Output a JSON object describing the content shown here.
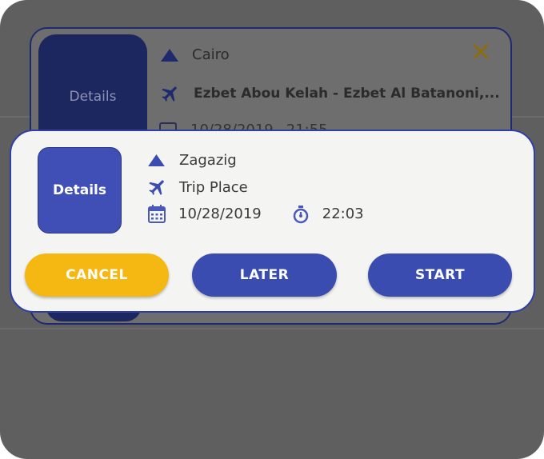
{
  "background_card": {
    "details_label": "Details",
    "from": "Cairo",
    "to": "Ezbet Abou Kelah - Ezbet Al Batanoni,...",
    "date": "10/28/2019",
    "time": "21:55",
    "close_icon": "close-x-icon"
  },
  "dialog": {
    "details_label": "Details",
    "from": "Zagazig",
    "to": "Trip Place",
    "date": "10/28/2019",
    "time": "22:03",
    "buttons": {
      "cancel": "CANCEL",
      "later": "LATER",
      "start": "START"
    }
  },
  "colors": {
    "accent_blue": "#3b4cb1",
    "cancel_yellow": "#f5b812",
    "dialog_bg": "#f4f5f3",
    "overlay": "#5f5f5f"
  },
  "icons": {
    "origin": "triangle-up-icon",
    "destination": "airplane-icon",
    "date": "calendar-icon",
    "time": "stopwatch-icon"
  }
}
